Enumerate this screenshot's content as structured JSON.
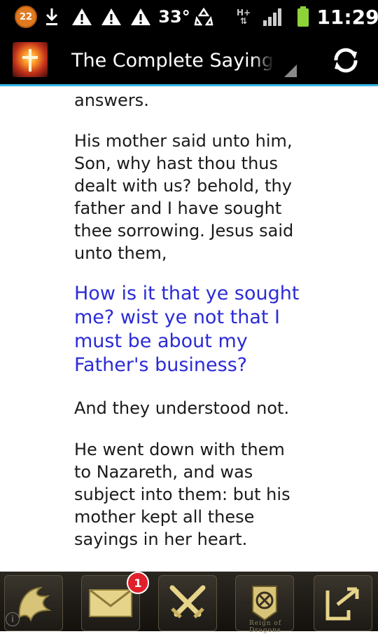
{
  "status_bar": {
    "notification_count": "22",
    "temperature": "33°",
    "network": "H+",
    "time": "11:29",
    "icons": [
      "notification-badge-icon",
      "download-icon",
      "warning-icon",
      "warning-icon",
      "warning-icon",
      "recycle-icon",
      "signal-icon",
      "battery-icon"
    ],
    "battery_color": "#8ed33a"
  },
  "action_bar": {
    "title": "The Complete Sayings o",
    "app_icon": "glowing-cross-icon",
    "refresh_icon": "refresh-icon",
    "accent_color": "#33b5e5"
  },
  "content": {
    "text_color": "#1a1a1a",
    "highlight_color": "#2b2bd6",
    "paragraphs": [
      {
        "text": "answers.",
        "highlight": false
      },
      {
        "text": "His mother said unto him, Son, why hast thou thus dealt with us? behold, thy father and I have sought thee sorrowing. Jesus said unto them,",
        "highlight": false
      },
      {
        "text": "How is it that ye sought me? wist ye not that I must be about my Father's business?",
        "highlight": true
      },
      {
        "text": "And they understood not.",
        "highlight": false
      },
      {
        "text": "He went down with them to Nazareth, and was subject into them: but his mother kept all these sayings in her heart.",
        "highlight": false
      }
    ]
  },
  "bottom_bar": {
    "items": [
      {
        "icon": "dragon-icon"
      },
      {
        "icon": "mail-icon",
        "badge": "1"
      },
      {
        "icon": "crossed-swords-icon"
      },
      {
        "icon": "emblem-icon"
      },
      {
        "icon": "exit-icon"
      }
    ],
    "info_label": "i",
    "wordmark": "Reign of Dragons"
  }
}
